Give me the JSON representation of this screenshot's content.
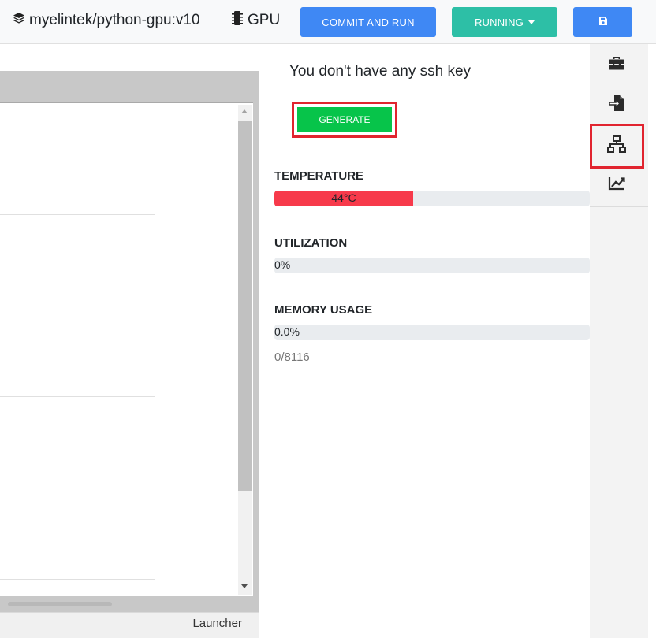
{
  "header": {
    "project_name": "myelintek/python-gpu:v10",
    "gpu_label": "GPU",
    "commit_button": "COMMIT AND RUN",
    "running_button": "RUNNING"
  },
  "ssh": {
    "message": "You don't have any ssh key",
    "generate_button": "GENERATE"
  },
  "metrics": {
    "temperature": {
      "label": "TEMPERATURE",
      "value_text": "44°C",
      "fraction": 0.44
    },
    "utilization": {
      "label": "UTILIZATION",
      "value_text": "0%",
      "fraction": 0
    },
    "memory": {
      "label": "MEMORY USAGE",
      "value_text": "0.0%",
      "fraction": 0,
      "count_text": "0/8116"
    }
  },
  "editor": {
    "status_tab": "Launcher"
  },
  "sidebar": {
    "items": [
      "toolbox-icon",
      "file-import-icon",
      "network-icon",
      "chart-line-icon"
    ],
    "active": "network-icon"
  },
  "colors": {
    "primary": "#3f88f4",
    "teal": "#2dbfa6",
    "success": "#07c44a",
    "danger_bar": "#f73a4b",
    "highlight": "#e1242f"
  }
}
